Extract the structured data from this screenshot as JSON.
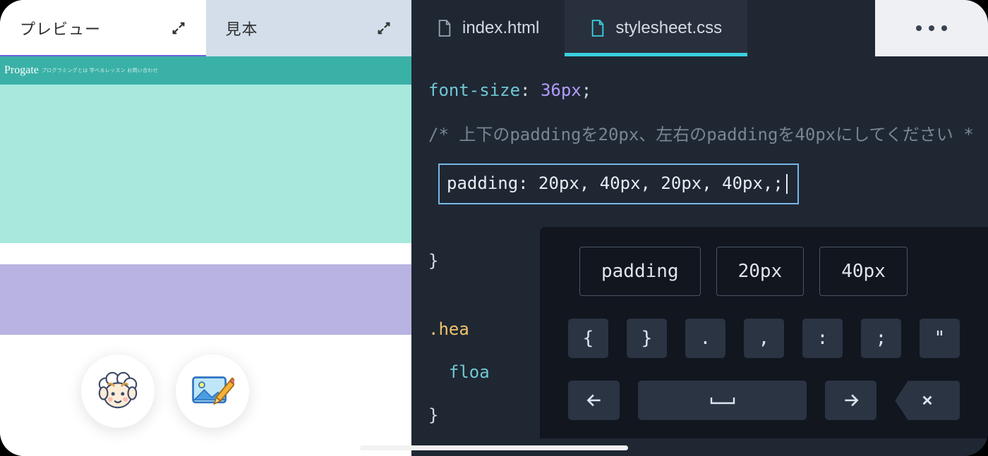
{
  "left": {
    "tabs": {
      "preview": "プレビュー",
      "sample": "見本"
    },
    "preview_logo": "Progate",
    "preview_submenu": "プログラミングとは 学べるレッスン お問い合わせ"
  },
  "editor": {
    "tabs": {
      "html": "index.html",
      "css": "stylesheet.css"
    },
    "code": {
      "line1_prop": "font-size",
      "line1_colon": ": ",
      "line1_val": "36px",
      "line1_semi": ";",
      "comment": "/* 上下のpaddingを20px、左右のpaddingを40pxにしてください *",
      "input_value": "padding: 20px, 40px, 20px, 40px,;",
      "brace_close": "}",
      "selector_hea": ".hea",
      "float_prefix": "floa",
      "brace_close2": "}"
    }
  },
  "keyboard": {
    "suggestions": [
      "padding",
      "20px",
      "40px"
    ],
    "symbols": [
      "{",
      "}",
      ".",
      ",",
      ":",
      ";",
      "\""
    ],
    "bottom": {
      "left_arrow": "←",
      "space": "␣",
      "right_arrow": "→",
      "backspace": "✕"
    }
  }
}
